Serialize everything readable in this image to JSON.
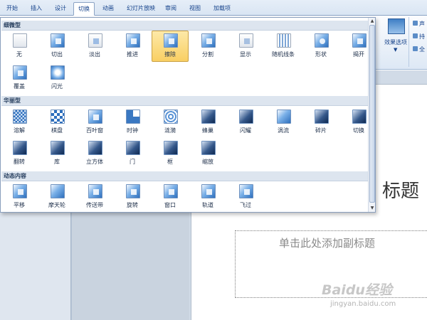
{
  "tabs": [
    {
      "label": "开始",
      "active": false
    },
    {
      "label": "插入",
      "active": false
    },
    {
      "label": "设计",
      "active": false
    },
    {
      "label": "切换",
      "active": true
    },
    {
      "label": "动画",
      "active": false
    },
    {
      "label": "幻灯片放映",
      "active": false
    },
    {
      "label": "审阅",
      "active": false
    },
    {
      "label": "视图",
      "active": false
    },
    {
      "label": "加载项",
      "active": false
    }
  ],
  "ribbon": {
    "effect_options_label": "效果选项",
    "side_commands": [
      "声",
      "持",
      "全"
    ]
  },
  "gallery": {
    "groups": [
      {
        "label": "细微型",
        "items": [
          {
            "label": "无",
            "icon": "none-transition-icon",
            "selected": false
          },
          {
            "label": "切出",
            "icon": "cut-transition-icon",
            "selected": false
          },
          {
            "label": "淡出",
            "icon": "fade-transition-icon",
            "selected": false
          },
          {
            "label": "推进",
            "icon": "push-transition-icon",
            "selected": false
          },
          {
            "label": "擦除",
            "icon": "wipe-transition-icon",
            "selected": true
          },
          {
            "label": "分割",
            "icon": "split-transition-icon",
            "selected": false
          },
          {
            "label": "显示",
            "icon": "reveal-transition-icon",
            "selected": false
          },
          {
            "label": "随机线条",
            "icon": "random-bars-transition-icon",
            "selected": false
          },
          {
            "label": "形状",
            "icon": "shape-transition-icon",
            "selected": false
          },
          {
            "label": "揭开",
            "icon": "uncover-transition-icon",
            "selected": false
          },
          {
            "label": "覆盖",
            "icon": "cover-transition-icon",
            "selected": false
          },
          {
            "label": "闪光",
            "icon": "flash-transition-icon",
            "selected": false
          }
        ]
      },
      {
        "label": "华丽型",
        "items": [
          {
            "label": "溶解",
            "icon": "dissolve-transition-icon",
            "selected": false
          },
          {
            "label": "棋盘",
            "icon": "checkerboard-transition-icon",
            "selected": false
          },
          {
            "label": "百叶窗",
            "icon": "blinds-transition-icon",
            "selected": false
          },
          {
            "label": "时钟",
            "icon": "clock-transition-icon",
            "selected": false
          },
          {
            "label": "涟漪",
            "icon": "ripple-transition-icon",
            "selected": false
          },
          {
            "label": "蜂巢",
            "icon": "honeycomb-transition-icon",
            "selected": false
          },
          {
            "label": "闪耀",
            "icon": "glitter-transition-icon",
            "selected": false
          },
          {
            "label": "涡流",
            "icon": "vortex-transition-icon",
            "selected": false
          },
          {
            "label": "碎片",
            "icon": "shred-transition-icon",
            "selected": false
          },
          {
            "label": "切换",
            "icon": "switch-transition-icon",
            "selected": false
          },
          {
            "label": "翻转",
            "icon": "flip-transition-icon",
            "selected": false
          },
          {
            "label": "库",
            "icon": "gallery-transition-icon",
            "selected": false
          },
          {
            "label": "立方体",
            "icon": "cube-transition-icon",
            "selected": false
          },
          {
            "label": "门",
            "icon": "doors-transition-icon",
            "selected": false
          },
          {
            "label": "框",
            "icon": "box-transition-icon",
            "selected": false
          },
          {
            "label": "缩放",
            "icon": "zoom-transition-icon",
            "selected": false
          }
        ]
      },
      {
        "label": "动态内容",
        "items": [
          {
            "label": "平移",
            "icon": "pan-transition-icon",
            "selected": false
          },
          {
            "label": "摩天轮",
            "icon": "ferris-wheel-transition-icon",
            "selected": false
          },
          {
            "label": "传送带",
            "icon": "conveyor-transition-icon",
            "selected": false
          },
          {
            "label": "旋转",
            "icon": "rotate-transition-icon",
            "selected": false
          },
          {
            "label": "窗口",
            "icon": "window-transition-icon",
            "selected": false
          },
          {
            "label": "轨道",
            "icon": "orbit-transition-icon",
            "selected": false
          },
          {
            "label": "飞过",
            "icon": "fly-through-transition-icon",
            "selected": false
          }
        ]
      }
    ]
  },
  "slide": {
    "title_fragment": "标题",
    "subtitle_placeholder": "单击此处添加副标题"
  },
  "watermark": {
    "logo_text": "Baidu经验",
    "url": "jingyan.baidu.com"
  }
}
